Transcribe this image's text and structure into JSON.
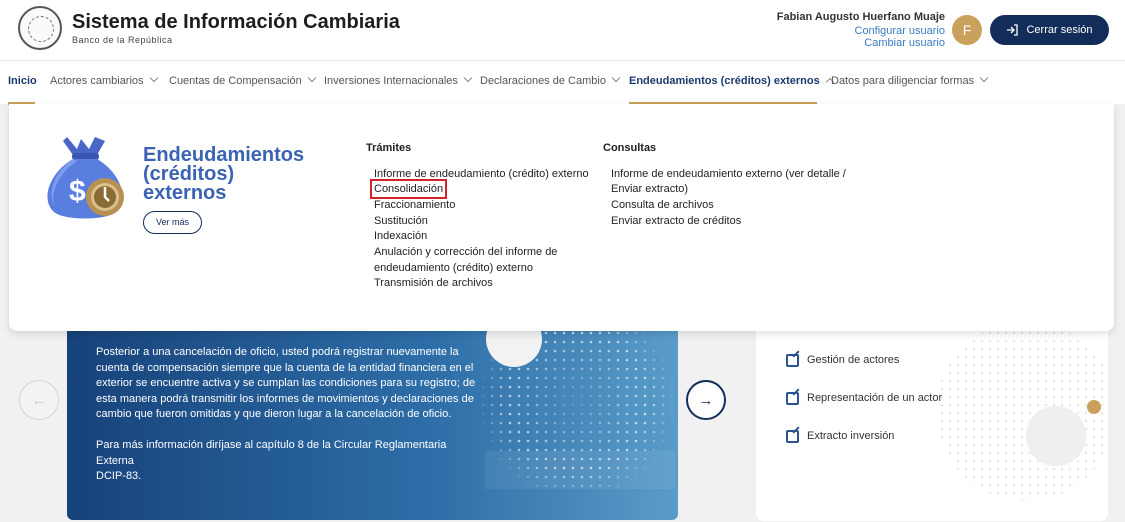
{
  "header": {
    "title": "Sistema de Información Cambiaria",
    "subtitle": "Banco de la República",
    "user_name": "Fabian Augusto Huerfano Muaje",
    "configure_user": "Configurar usuario",
    "change_user": "Cambiar usuario",
    "avatar_initial": "F",
    "logout_label": "Cerrar sesión"
  },
  "nav": {
    "items": [
      {
        "label": "Inicio"
      },
      {
        "label": "Actores cambiarios"
      },
      {
        "label": "Cuentas de Compensación"
      },
      {
        "label": "Inversiones Internacionales"
      },
      {
        "label": "Declaraciones de Cambio"
      },
      {
        "label": "Endeudamientos (créditos) externos"
      },
      {
        "label": "Datos para diligenciar formas"
      }
    ]
  },
  "mega": {
    "title_line1": "Endeudamientos",
    "title_line2": "(créditos)",
    "title_line3": "externos",
    "more_label": "Ver más",
    "tramites_title": "Trámites",
    "tramites": [
      "Informe de endeudamiento (crédito) externo",
      "Consolidación",
      "Fraccionamiento",
      "Sustitución",
      "Indexación",
      "Anulación y corrección del informe de",
      "endeudamiento (crédito) externo",
      "Transmisión de archivos"
    ],
    "consultas_title": "Consultas",
    "consultas": [
      "Informe de endeudamiento externo (ver detalle /",
      "Enviar extracto)",
      "Consulta de archivos",
      "Enviar extracto de créditos"
    ]
  },
  "banner": {
    "paragraph1_lines": [
      "Posterior a una cancelación de oficio, usted podrá registrar nuevamente la",
      "cuenta de compensación siempre que la cuenta de la entidad financiera en el",
      "exterior se encuentre activa y se cumplan las condiciones para su registro; de",
      "esta manera podrá transmitir los informes de movimientos y declaraciones de",
      "cambio que fueron omitidas y que dieron lugar a la cancelación de oficio."
    ],
    "paragraph2_lines": [
      "Para más información diríjase al capítulo 8 de la Circular Reglamentaria Externa",
      "DCIP-83."
    ]
  },
  "side": {
    "links": [
      "Gestión de actores",
      "Representación de un actor",
      "Extracto inversión"
    ]
  },
  "colors": {
    "navy": "#132d5a",
    "gold": "#c9a15c",
    "accent_blue": "#3b63b3",
    "highlight_red": "#d2232a"
  }
}
